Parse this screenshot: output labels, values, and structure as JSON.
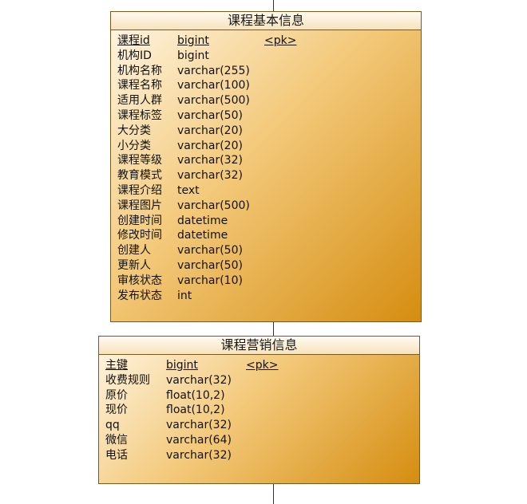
{
  "entities": [
    {
      "title": "课程基本信息",
      "attributes": [
        {
          "name": "课程id",
          "type": "bigint",
          "key": "<pk>",
          "underline": true
        },
        {
          "name": "机构ID",
          "type": "bigint",
          "key": ""
        },
        {
          "name": "机构名称",
          "type": "varchar(255)",
          "key": ""
        },
        {
          "name": "课程名称",
          "type": "varchar(100)",
          "key": ""
        },
        {
          "name": "适用人群",
          "type": "varchar(500)",
          "key": ""
        },
        {
          "name": "课程标签",
          "type": "varchar(50)",
          "key": ""
        },
        {
          "name": "大分类",
          "type": "varchar(20)",
          "key": ""
        },
        {
          "name": "小分类",
          "type": "varchar(20)",
          "key": ""
        },
        {
          "name": "课程等级",
          "type": "varchar(32)",
          "key": ""
        },
        {
          "name": "教育模式",
          "type": "varchar(32)",
          "key": ""
        },
        {
          "name": "课程介绍",
          "type": "text",
          "key": ""
        },
        {
          "name": "课程图片",
          "type": "varchar(500)",
          "key": ""
        },
        {
          "name": "创建时间",
          "type": "datetime",
          "key": ""
        },
        {
          "name": "修改时间",
          "type": "datetime",
          "key": ""
        },
        {
          "name": "创建人",
          "type": "varchar(50)",
          "key": ""
        },
        {
          "name": "更新人",
          "type": "varchar(50)",
          "key": ""
        },
        {
          "name": "审核状态",
          "type": "varchar(10)",
          "key": ""
        },
        {
          "name": "发布状态",
          "type": "int",
          "key": ""
        }
      ]
    },
    {
      "title": "课程营销信息",
      "attributes": [
        {
          "name": "主键",
          "type": "bigint",
          "key": "<pk>",
          "underline": true
        },
        {
          "name": "收费规则",
          "type": "varchar(32)",
          "key": ""
        },
        {
          "name": "原价",
          "type": "float(10,2)",
          "key": ""
        },
        {
          "name": "现价",
          "type": "float(10,2)",
          "key": ""
        },
        {
          "name": "qq",
          "type": "varchar(32)",
          "key": ""
        },
        {
          "name": "微信",
          "type": "varchar(64)",
          "key": ""
        },
        {
          "name": "电话",
          "type": "varchar(32)",
          "key": ""
        }
      ]
    }
  ]
}
